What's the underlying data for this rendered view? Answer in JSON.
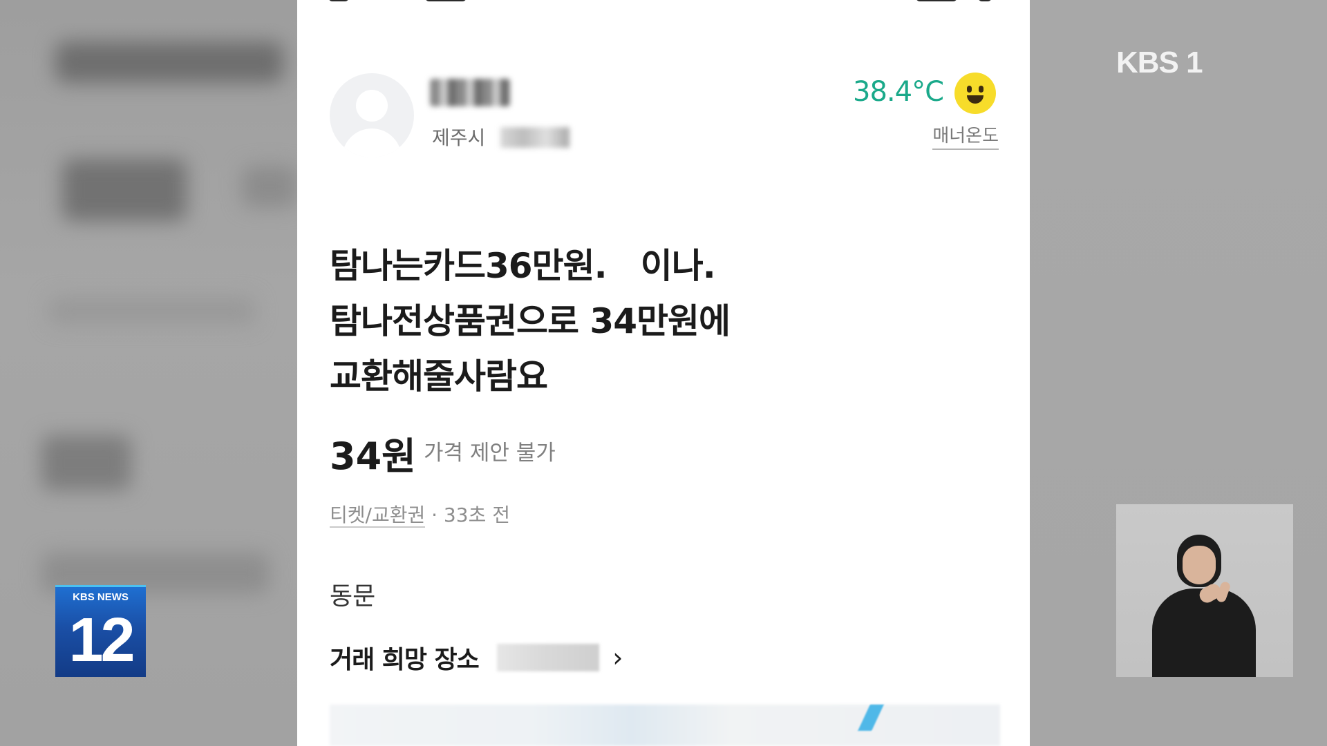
{
  "broadcast": {
    "channel_logo": "KBS 1",
    "badge_label": "KBS NEWS",
    "badge_number": "12"
  },
  "listing": {
    "seller": {
      "location": "제주시",
      "manner_temperature": "38.4°C",
      "manner_label": "매너온도",
      "temperature_icon": "smiley-face-icon"
    },
    "title_lines": [
      "탐나는카드36만원.   이나.",
      "탐나전상품권으로 34만원에",
      "교환해줄사람요"
    ],
    "price": "34원",
    "price_note": "가격 제안 불가",
    "category": "티켓/교환권",
    "posted": " · 33초 전",
    "neighborhood": "동문",
    "trade_place_label": "거래 희망 장소",
    "trade_place_icon": "chevron-right-icon"
  },
  "colors": {
    "temperature": "#1aa98a",
    "badge_blue": "#1a4fa6",
    "smile_yellow": "#f7dc2a"
  }
}
